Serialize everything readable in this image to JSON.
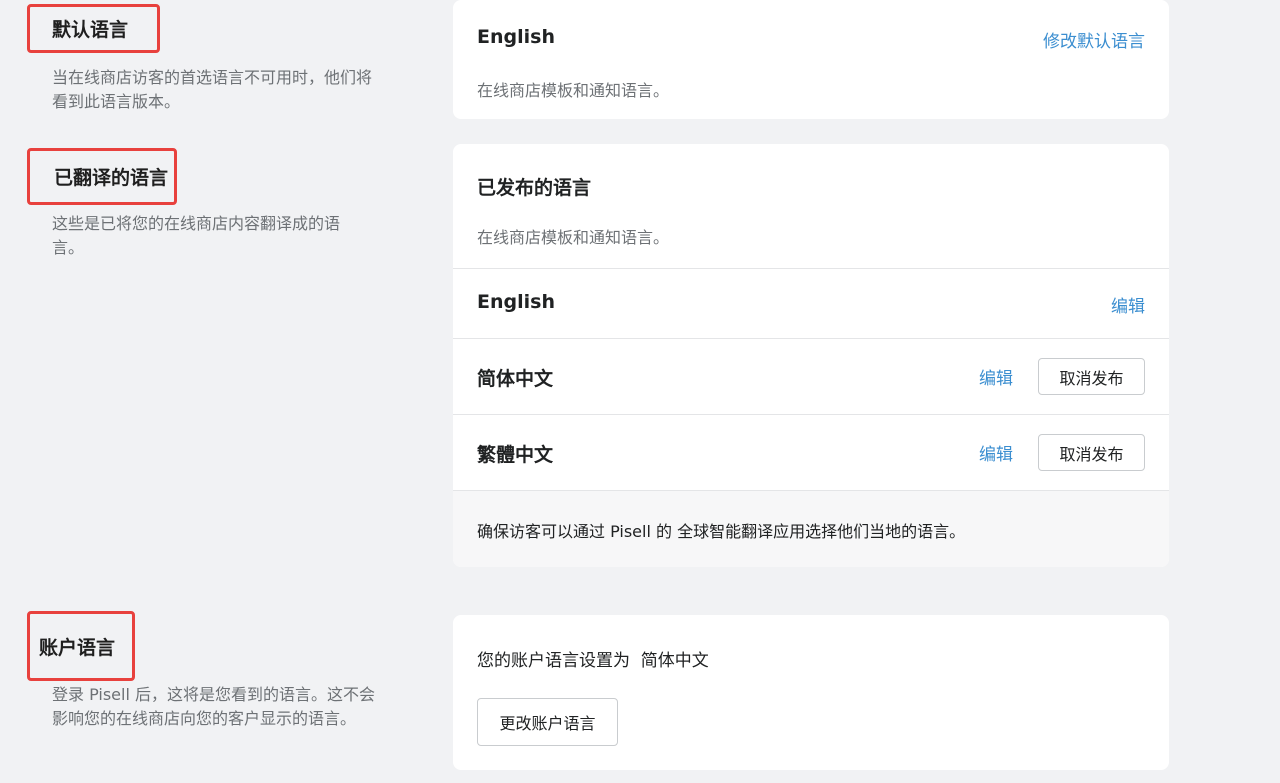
{
  "default_language": {
    "title": "默认语言",
    "description": "当在线商店访客的首选语言不可用时，他们将 看到此语言版本。",
    "card": {
      "language": "English",
      "change_link": "修改默认语言",
      "subtitle": "在线商店模板和通知语言。"
    }
  },
  "translated_languages": {
    "title": "已翻译的语言",
    "description": "这些是已将您的在线商店内容翻译成的语言。",
    "card": {
      "heading": "已发布的语言",
      "subtitle": "在线商店模板和通知语言。",
      "languages": [
        {
          "name": "English",
          "edit_label": "编辑"
        },
        {
          "name": "简体中文",
          "edit_label": "编辑",
          "unpublish_label": "取消发布"
        },
        {
          "name": "繁體中文",
          "edit_label": "编辑",
          "unpublish_label": "取消发布"
        }
      ],
      "footer_note": "确保访客可以通过 Pisell 的 全球智能翻译应用选择他们当地的语言。"
    }
  },
  "account_language": {
    "title": "账户语言",
    "description": "登录 Pisell 后，这将是您看到的语言。这不会影响您的在线商店向您的客户显示的语言。",
    "card": {
      "text": "您的账户语言设置为  简体中文",
      "change_button": "更改账户语言"
    }
  }
}
